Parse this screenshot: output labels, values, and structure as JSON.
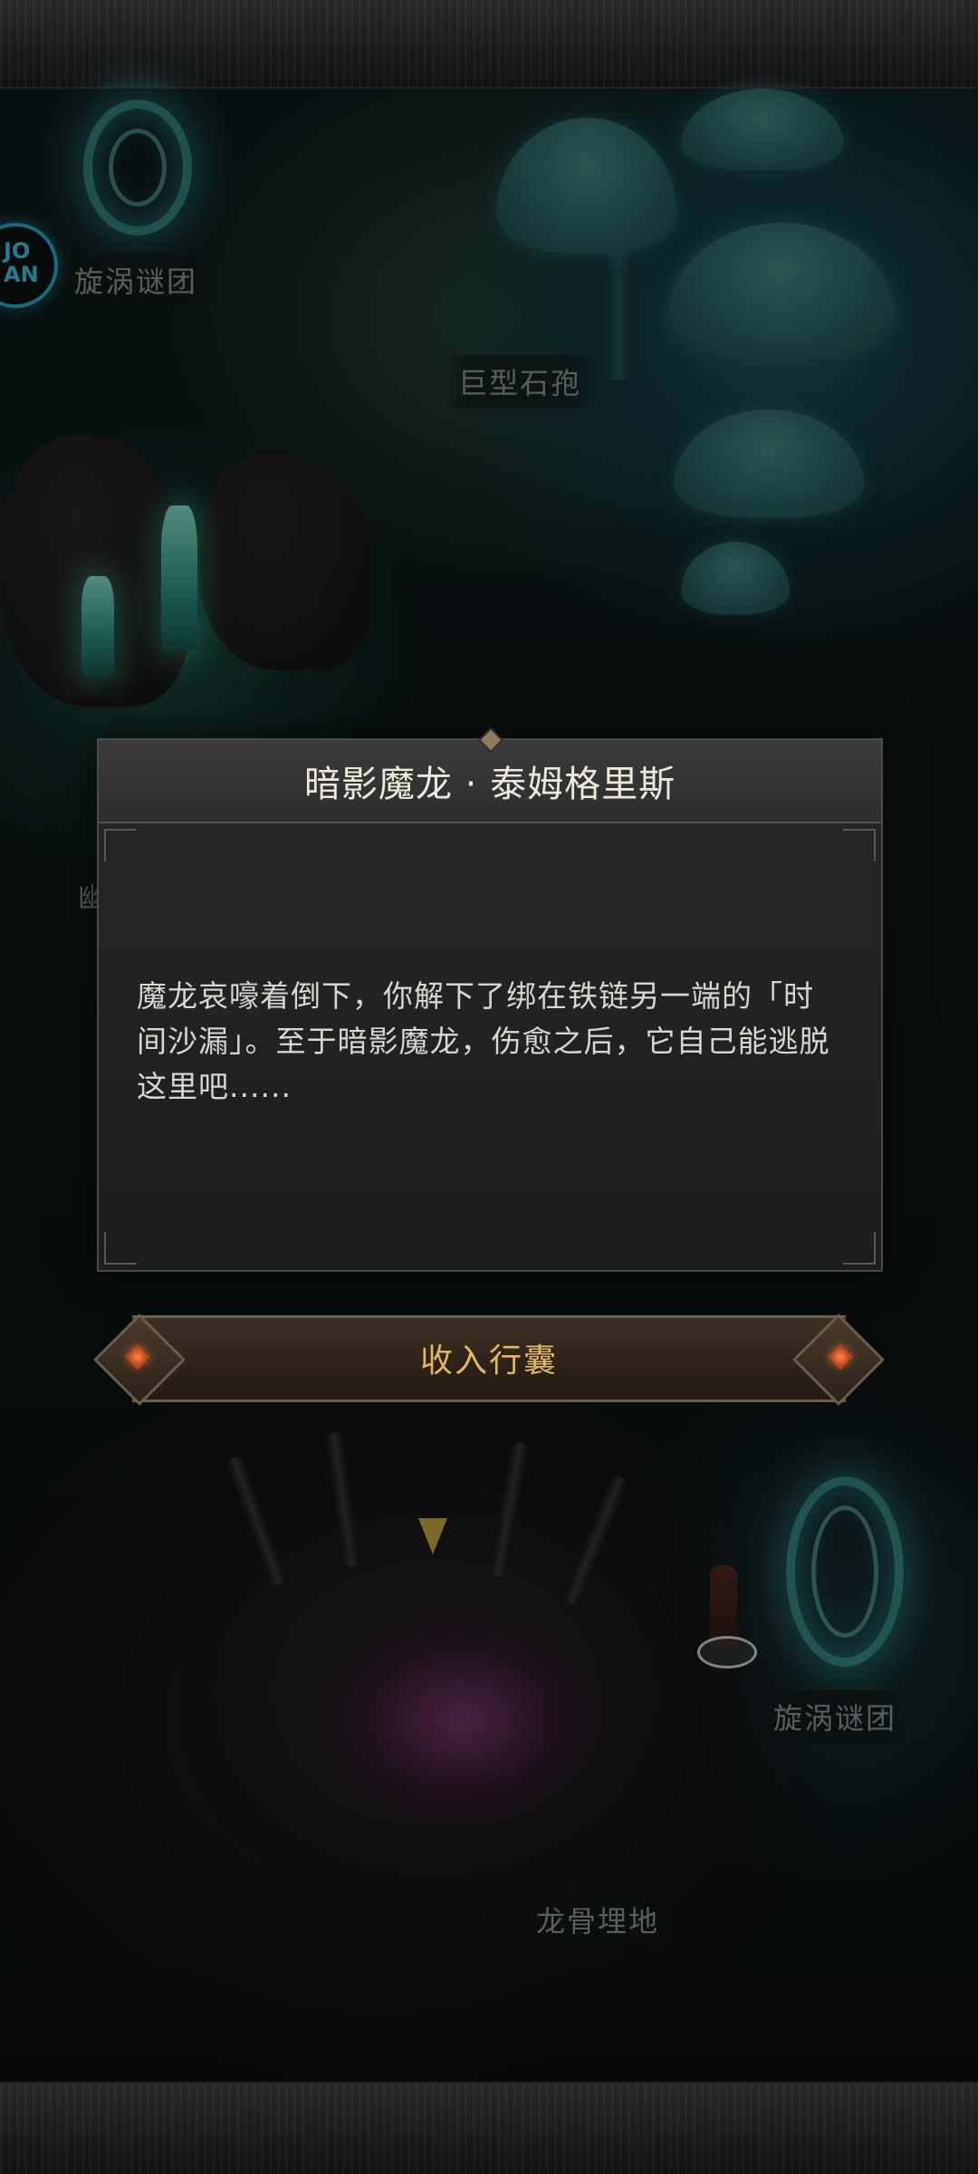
{
  "map": {
    "labels": {
      "vortex_top": "旋涡谜团",
      "giant_spore": "巨型石孢",
      "partial_left": "幽",
      "vortex_bottom": "旋涡谜团",
      "dragon_bone": "龙骨埋地"
    }
  },
  "dialog": {
    "title": "暗影魔龙 · 泰姆格里斯",
    "body": "魔龙哀嚎着倒下，你解下了绑在铁链另一端的「时间沙漏」。至于暗影魔龙，伤愈之后，它自己能逃脱这里吧......"
  },
  "actions": {
    "collect_label": "收入行囊"
  },
  "avatar": {
    "glyph": "JO\nAN"
  },
  "colors": {
    "accent_gold": "#e0b763",
    "portal_cyan": "#54e6dc",
    "marker_gold": "#d7b44a"
  },
  "icons": {
    "map_marker": "arrow-down-icon",
    "portal": "vortex-portal-icon",
    "button_gems": "diamond-gem-icon"
  }
}
